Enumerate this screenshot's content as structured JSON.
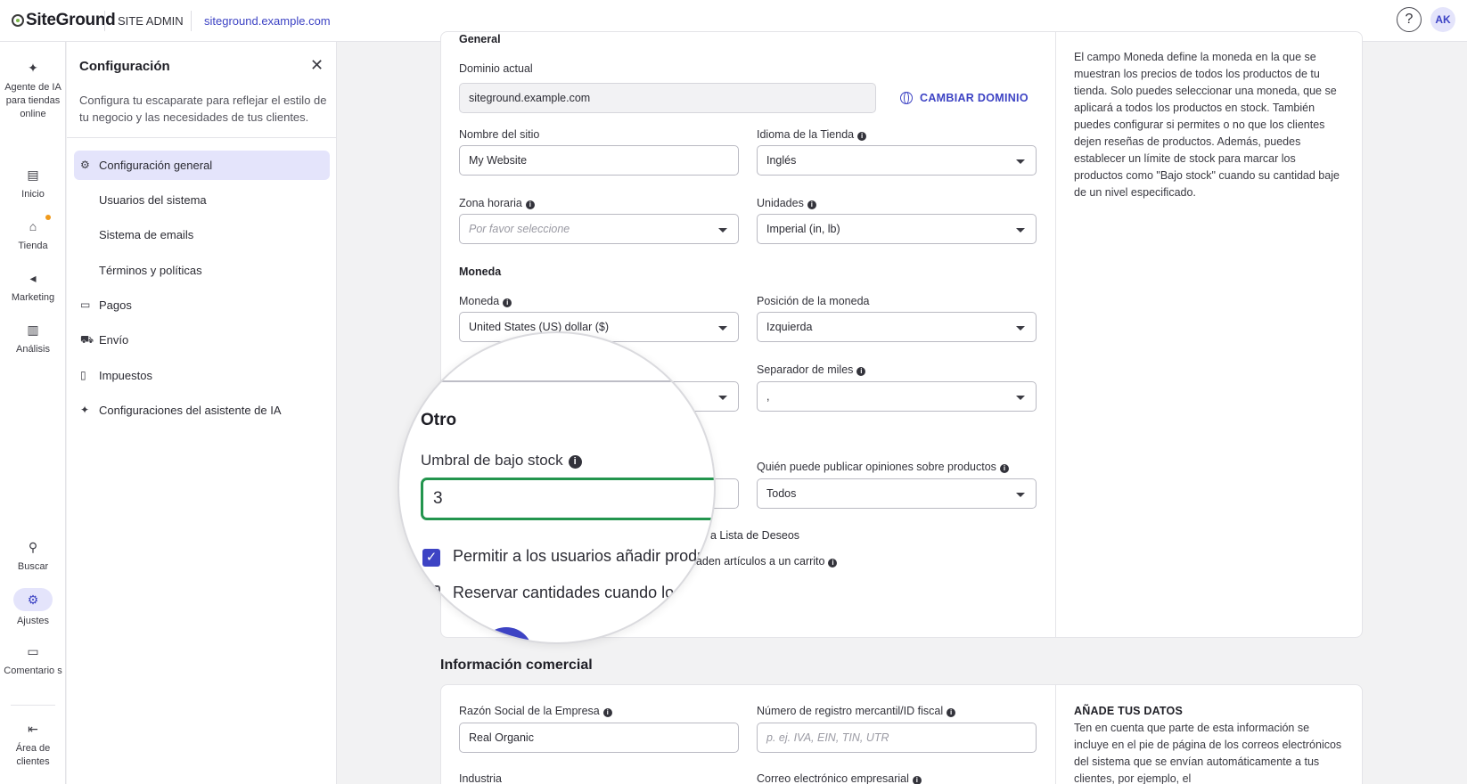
{
  "topbar": {
    "logo": "SiteGround",
    "site_admin": "SITE ADMIN",
    "site_url": "siteground.example.com",
    "help": "?",
    "avatar": "AK"
  },
  "rail": {
    "items": [
      {
        "icon": "sparkle-icon",
        "label": "Agente de IA para tiendas online"
      },
      {
        "icon": "home-icon",
        "label": "Inicio"
      },
      {
        "icon": "store-icon",
        "label": "Tienda"
      },
      {
        "icon": "megaphone-icon",
        "label": "Marketing"
      },
      {
        "icon": "analytics-icon",
        "label": "Análisis"
      },
      {
        "icon": "search-icon",
        "label": "Buscar"
      },
      {
        "icon": "gear-icon",
        "label": "Ajustes"
      },
      {
        "icon": "comment-icon",
        "label": "Comentario s"
      },
      {
        "icon": "exit-icon",
        "label": "Área de clientes"
      }
    ],
    "notification_color": "#f09a1c"
  },
  "panel": {
    "title": "Configuración",
    "description": "Configura tu escaparate para reflejar el estilo de tu negocio y las necesidades de tus clientes.",
    "nav": [
      {
        "label": "Configuración general",
        "icon": "gear-icon",
        "active": true
      },
      {
        "label": "Usuarios del sistema"
      },
      {
        "label": "Sistema de emails"
      },
      {
        "label": "Términos y políticas"
      },
      {
        "label": "Pagos",
        "icon": "card-icon"
      },
      {
        "label": "Envío",
        "icon": "truck-icon"
      },
      {
        "label": "Impuestos",
        "icon": "document-icon"
      },
      {
        "label": "Configuraciones del asistente de IA",
        "icon": "sparkle-icon"
      }
    ]
  },
  "general": {
    "heading": "General",
    "domain_label": "Dominio actual",
    "domain_value": "siteground.example.com",
    "change_domain": "CAMBIAR DOMINIO",
    "site_name_label": "Nombre del sitio",
    "site_name_value": "My Website",
    "store_lang_label": "Idioma de la Tienda",
    "store_lang_value": "Inglés",
    "timezone_label": "Zona horaria",
    "timezone_placeholder": "Por favor seleccione",
    "units_label": "Unidades",
    "units_value": "Imperial (in, lb)"
  },
  "currency": {
    "heading": "Moneda",
    "currency_label": "Moneda",
    "currency_value": "United States (US) dollar ($)",
    "position_label": "Posición de la moneda",
    "position_value": "Izquierda",
    "thousands_label": "Separador de miles",
    "thousands_value": ","
  },
  "other": {
    "reviews_label": "Quién puede publicar opiniones sobre productos",
    "reviews_value": "Todos",
    "wishlist_tail": "a Lista de Deseos",
    "reserve_tail": "ñaden artículos a un carrito"
  },
  "magnifier": {
    "section": "Otro",
    "low_stock_label": "Umbral de bajo stock",
    "low_stock_value": "3",
    "wishlist_text": "Permitir a los usuarios añadir produ",
    "reserve_text": "Reservar cantidades cuando lo",
    "check_mark": "✓",
    "input_border_color": "#23954e",
    "check_color": "#3d43c4"
  },
  "sidebar_help": {
    "text": "El campo Moneda define la moneda en la que se muestran los precios de todos los productos de tu tienda. Solo puedes seleccionar una moneda, que se aplicará a todos los productos en stock. También puedes configurar si permites o no que los clientes dejen reseñas de productos. Además, puedes establecer un límite de stock para marcar los productos como \"Bajo stock\" cuando su cantidad baje de un nivel especificado."
  },
  "business": {
    "heading": "Información comercial",
    "company_label": "Razón Social de la Empresa",
    "company_value": "Real Organic",
    "taxid_label": "Número de registro mercantil/ID fiscal",
    "taxid_placeholder": "p. ej. IVA, EIN, TIN, UTR",
    "industry_label": "Industria",
    "email_label": "Correo electrónico empresarial",
    "side_head": "AÑADE TUS DATOS",
    "side_text": "Ten en cuenta que parte de esta información se incluye en el pie de página de los correos electrónicos del sistema que se envían automáticamente a tus clientes, por ejemplo, el"
  },
  "colors": {
    "accent": "#3d43c4",
    "accent_soft": "#e4e4fb"
  }
}
